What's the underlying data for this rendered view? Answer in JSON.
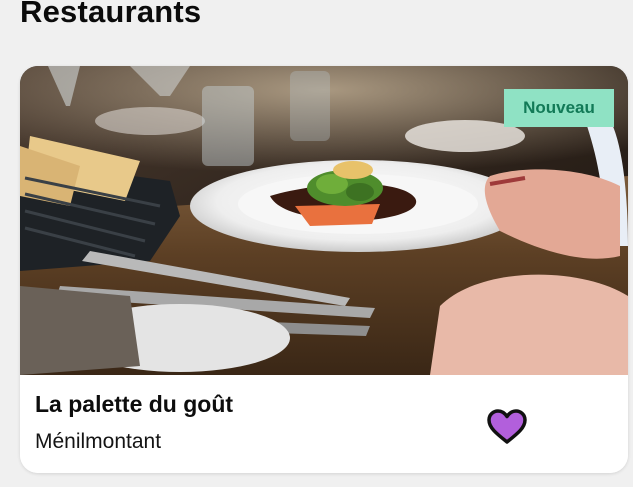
{
  "section": {
    "title": "Restaurants"
  },
  "card": {
    "badge": "Nouveau",
    "name": "La palette du goût",
    "location": "Ménilmontant",
    "favorite_icon": "heart-icon",
    "favorite_color": "#b25fdc",
    "badge_color": "#8fe2c4",
    "badge_text_color": "#127a57"
  }
}
